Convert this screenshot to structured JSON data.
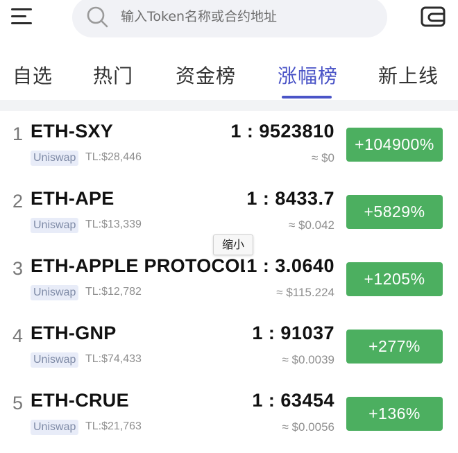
{
  "header": {
    "search": {
      "placeholder": "输入Token名称或合约地址",
      "value": ""
    },
    "icons": {
      "menu": "menu-icon",
      "search": "search-icon",
      "wallet": "wallet-icon"
    }
  },
  "tabs": [
    {
      "label": "自选",
      "active": false
    },
    {
      "label": "热门",
      "active": false
    },
    {
      "label": "资金榜",
      "active": false
    },
    {
      "label": "涨幅榜",
      "active": true
    },
    {
      "label": "新上线",
      "active": false
    }
  ],
  "tooltip": "缩小",
  "colors": {
    "accent": "#4a54c7",
    "gain": "#4caf60"
  },
  "rows": [
    {
      "rank": "1",
      "pair": "ETH-SXY",
      "dex": "Uniswap",
      "tl": "TL:$28,446",
      "ratio": "1 : 9523810",
      "usd": "≈ $0",
      "change": "+104900%"
    },
    {
      "rank": "2",
      "pair": "ETH-APE",
      "dex": "Uniswap",
      "tl": "TL:$13,339",
      "ratio": "1 : 8433.7",
      "usd": "≈ $0.042",
      "change": "+5829%"
    },
    {
      "rank": "3",
      "pair": "ETH-APPLE PROTOCOL",
      "dex": "Uniswap",
      "tl": "TL:$12,782",
      "ratio": "1 : 3.0640",
      "usd": "≈ $115.224",
      "change": "+1205%"
    },
    {
      "rank": "4",
      "pair": "ETH-GNP",
      "dex": "Uniswap",
      "tl": "TL:$74,433",
      "ratio": "1 : 91037",
      "usd": "≈ $0.0039",
      "change": "+277%"
    },
    {
      "rank": "5",
      "pair": "ETH-CRUE",
      "dex": "Uniswap",
      "tl": "TL:$21,763",
      "ratio": "1 : 63454",
      "usd": "≈ $0.0056",
      "change": "+136%"
    }
  ]
}
